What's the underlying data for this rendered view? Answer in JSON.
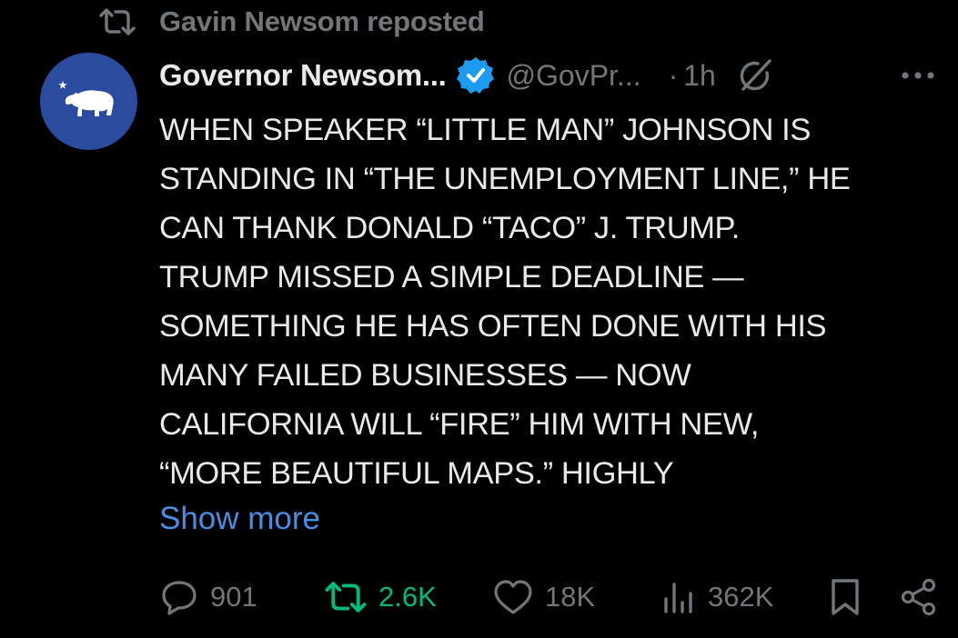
{
  "repost_banner": {
    "text": "Gavin Newsom reposted",
    "icon": "repost-icon"
  },
  "tweet": {
    "author": {
      "display_name": "Governor Newsom...",
      "handle": "@GovPr...",
      "verified": true,
      "avatar_icon": "california-bear-icon"
    },
    "time": "1h",
    "separator": "·",
    "lines": [
      "WHEN SPEAKER “LITTLE MAN” JOHNSON IS",
      "STANDING IN “THE UNEMPLOYMENT LINE,” HE",
      "CAN THANK DONALD “TACO” J. TRUMP.",
      "TRUMP MISSED A SIMPLE DEADLINE —",
      "SOMETHING HE HAS OFTEN DONE WITH HIS",
      "MANY FAILED BUSINESSES — NOW",
      "CALIFORNIA WILL “FIRE” HIM WITH NEW,",
      "“MORE BEAUTIFUL MAPS.” HIGHLY"
    ],
    "show_more": "Show more"
  },
  "actions": {
    "replies": "901",
    "reposts": "2.6K",
    "likes": "18K",
    "views": "362K"
  },
  "colors": {
    "background": "#000000",
    "text": "#e7e9ea",
    "muted": "#71767b",
    "link": "#4a8ee3",
    "repost_green": "#00ba7c",
    "verified_blue": "#1d9bf0",
    "avatar_bg": "#2a4b9e"
  }
}
